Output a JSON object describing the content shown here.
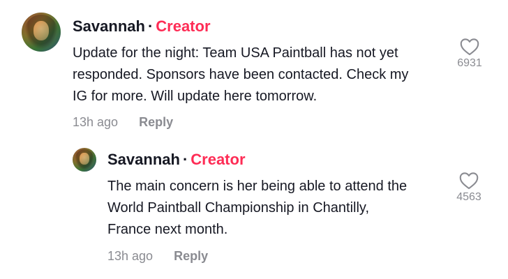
{
  "comments": [
    {
      "username": "Savannah",
      "separator": "·",
      "badge": "Creator",
      "lines": [
        "Update for the night: Team USA Paintball has not yet",
        "responded. Sponsors have been contacted. Check my",
        "IG for more. Will update here tomorrow."
      ],
      "time": "13h ago",
      "reply_label": "Reply",
      "like_count": "6931",
      "like_icon": "heart-outline-icon"
    },
    {
      "username": "Savannah",
      "separator": "·",
      "badge": "Creator",
      "lines": [
        "The main concern is her being able to attend the",
        "World Paintball Championship in Chantilly,",
        "France next month."
      ],
      "time": "13h ago",
      "reply_label": "Reply",
      "like_count": "4563",
      "like_icon": "heart-outline-icon"
    }
  ],
  "colors": {
    "creator_badge": "#fe2c55",
    "meta_text": "#8a8b91",
    "primary_text": "#161823"
  }
}
